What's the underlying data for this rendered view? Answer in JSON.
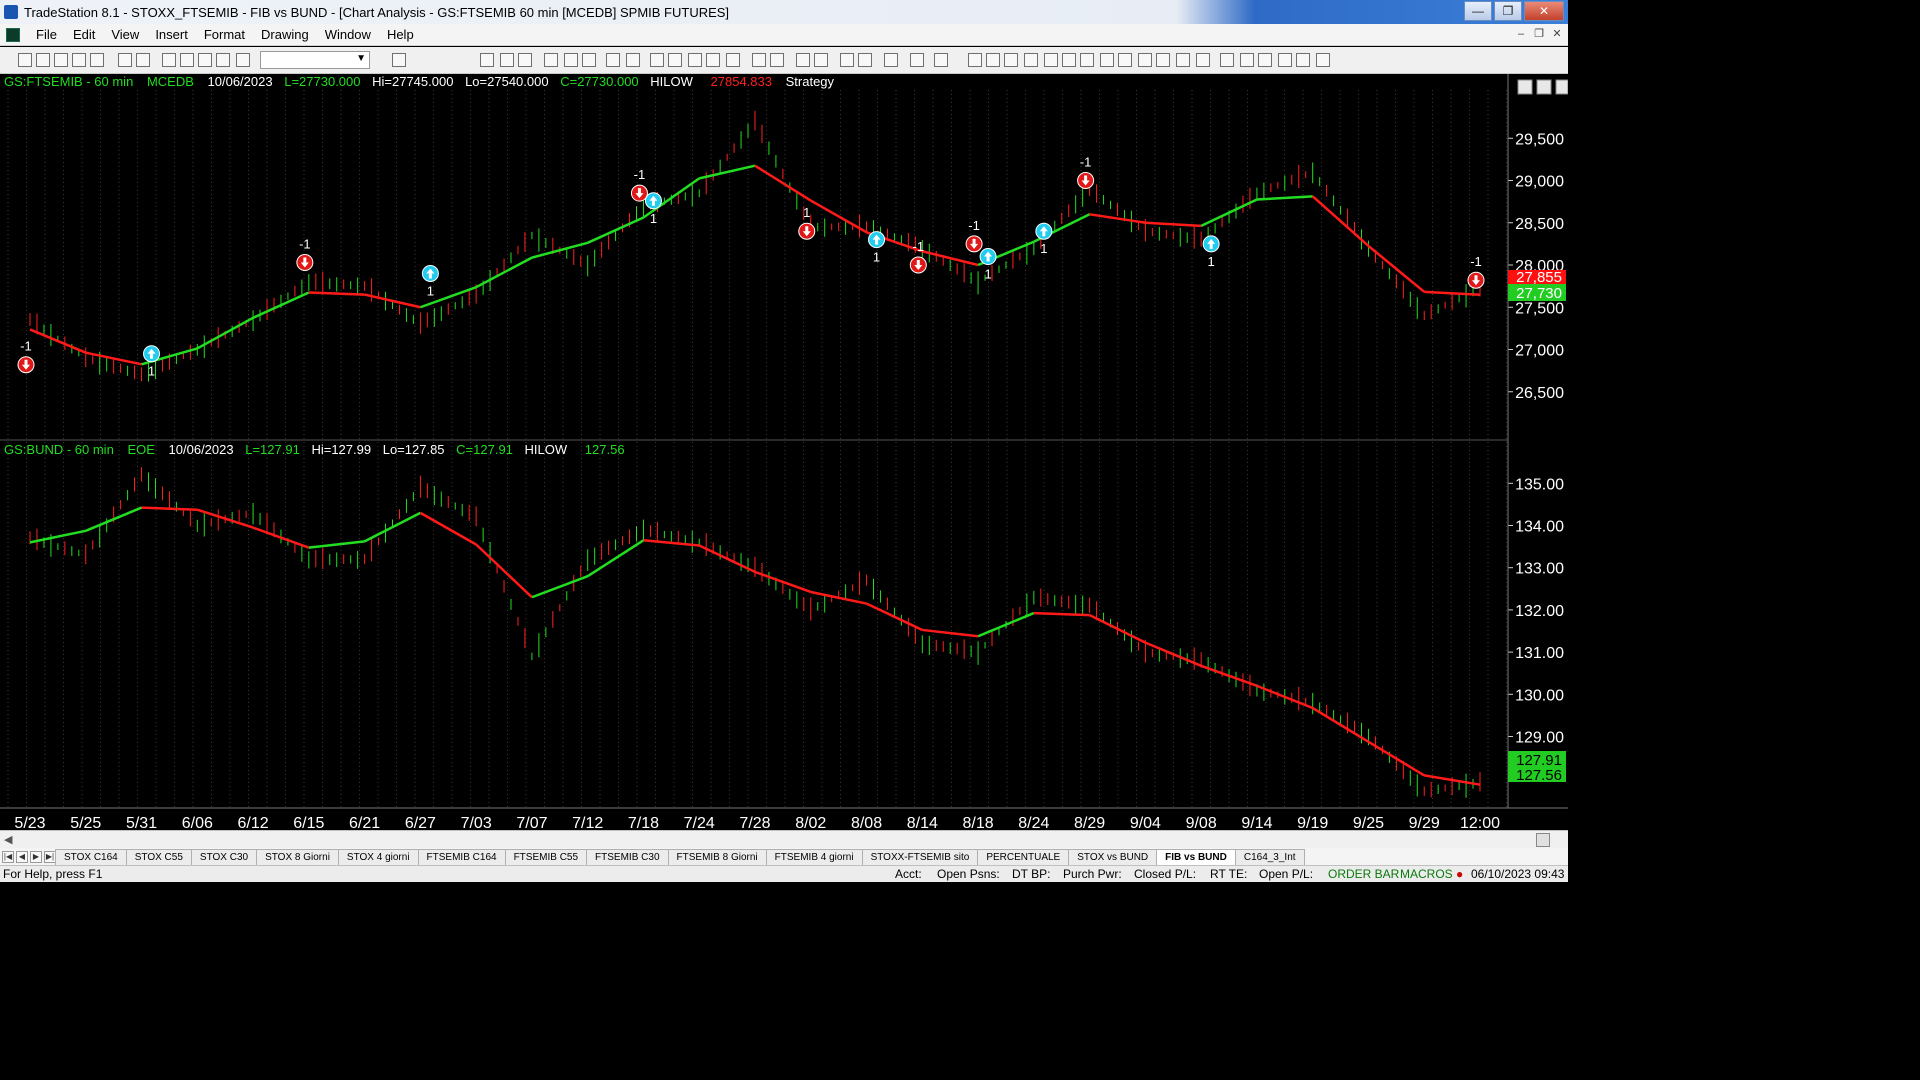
{
  "window": {
    "title": "TradeStation 8.1 - STOXX_FTSEMIB - FIB vs BUND - [Chart Analysis - GS:FTSEMIB  60 min  [MCEDB] SPMIB FUTURES]",
    "minimize": "—",
    "restore": "❐",
    "close": "✕"
  },
  "menu": [
    "File",
    "Edit",
    "View",
    "Insert",
    "Format",
    "Drawing",
    "Window",
    "Help"
  ],
  "panel1": {
    "symbol": "GS:FTSEMIB - 60 min",
    "exchange": "MCEDB",
    "date": "10/06/2023",
    "last": "L=27730.000",
    "high": "Hi=27745.000",
    "low": "Lo=27540.000",
    "close": "C=27730.000",
    "indicator": "HILOW",
    "indicator_value": "27854.833",
    "strategy": "Strategy",
    "price_tag_green": "27,730",
    "price_tag_red": "27,855"
  },
  "panel2": {
    "symbol": "GS:BUND - 60 min",
    "exchange": "EOE",
    "date": "10/06/2023",
    "last": "L=127.91",
    "high": "Hi=127.99",
    "low": "Lo=127.85",
    "close": "C=127.91",
    "indicator": "HILOW",
    "indicator_value": "127.56",
    "price_tag_green_1": "127.91",
    "price_tag_green_2": "127.56"
  },
  "chart_data": [
    {
      "type": "line",
      "title": "GS:FTSEMIB - 60 min",
      "y_ticks": [
        "29,500",
        "29,000",
        "28,500",
        "28,000",
        "27,500",
        "27,000",
        "26,500"
      ],
      "ylim": [
        26000,
        30000
      ],
      "x": [
        "5/23",
        "5/25",
        "5/31",
        "6/06",
        "6/12",
        "6/15",
        "6/21",
        "6/27",
        "7/03",
        "7/07",
        "7/12",
        "7/18",
        "7/24",
        "7/28",
        "8/02",
        "8/08",
        "8/14",
        "8/18",
        "8/24",
        "8/29",
        "9/04",
        "9/08",
        "9/14",
        "9/19",
        "9/25",
        "9/29",
        "12:00"
      ],
      "series": [
        {
          "name": "",
          "color": "#22dd22",
          "values": [
            27350,
            26900,
            26700,
            27000,
            27350,
            27800,
            27750,
            27300,
            27650,
            28350,
            28000,
            28700,
            28850,
            29700,
            28450,
            28450,
            28200,
            27800,
            28200,
            28900,
            28400,
            28300,
            28850,
            29100,
            28200,
            27400,
            27730
          ]
        }
      ],
      "signals": [
        {
          "type": "sell",
          "label": "-1",
          "date": "5/23",
          "value": 26820
        },
        {
          "type": "buy",
          "label": "1",
          "date": "5/31",
          "value": 26950
        },
        {
          "type": "sell",
          "label": "-1",
          "date": "6/15",
          "value": 28030
        },
        {
          "type": "buy",
          "label": "1",
          "date": "6/27",
          "value": 27900
        },
        {
          "type": "sell",
          "label": "-1",
          "date": "7/18",
          "value": 28850
        },
        {
          "type": "buy",
          "label": "1",
          "date": "7/18",
          "value": 28760
        },
        {
          "type": "sell",
          "label": "1",
          "date": "8/02",
          "value": 28400
        },
        {
          "type": "buy",
          "label": "1",
          "date": "8/08",
          "value": 28300
        },
        {
          "type": "sell",
          "label": "-1",
          "date": "8/14",
          "value": 28000
        },
        {
          "type": "buy",
          "label": "1",
          "date": "8/18",
          "value": 28100
        },
        {
          "type": "sell",
          "label": "-1",
          "date": "8/18",
          "value": 28250
        },
        {
          "type": "buy",
          "label": "1",
          "date": "8/24",
          "value": 28400
        },
        {
          "type": "sell",
          "label": "-1",
          "date": "8/29",
          "value": 29000
        },
        {
          "type": "buy",
          "label": "1",
          "date": "9/08",
          "value": 28250
        },
        {
          "type": "sell",
          "label": "-1",
          "date": "12:00",
          "value": 27820
        }
      ]
    },
    {
      "type": "line",
      "title": "GS:BUND - 60 min",
      "y_ticks": [
        "135.00",
        "134.00",
        "133.00",
        "132.00",
        "131.00",
        "130.00",
        "129.00"
      ],
      "ylim": [
        127.4,
        135.6
      ],
      "x": [
        "5/23",
        "5/25",
        "5/31",
        "6/06",
        "6/12",
        "6/15",
        "6/21",
        "6/27",
        "7/03",
        "7/07",
        "7/12",
        "7/18",
        "7/24",
        "7/28",
        "8/02",
        "8/08",
        "8/14",
        "8/18",
        "8/24",
        "8/29",
        "9/04",
        "9/08",
        "9/14",
        "9/19",
        "9/25",
        "9/29",
        "12:00"
      ],
      "series": [
        {
          "name": "",
          "color": "#22dd22",
          "values": [
            133.7,
            133.3,
            135.2,
            134.0,
            134.3,
            133.2,
            133.2,
            134.9,
            134.2,
            130.9,
            133.2,
            133.9,
            133.6,
            133.0,
            132.0,
            132.7,
            131.2,
            131.0,
            132.3,
            132.1,
            131.0,
            130.8,
            130.1,
            129.8,
            129.0,
            127.7,
            127.91
          ]
        }
      ]
    }
  ],
  "tabs": [
    "STOX C164",
    "STOX C55",
    "STOX  C30",
    "STOX  8 Giorni",
    "STOX 4 giorni",
    "FTSEMIB C164",
    "FTSEMIB C55",
    "FTSEMIB C30",
    "FTSEMIB  8 Giorni",
    "FTSEMIB  4 giorni",
    "STOXX-FTSEMIB sito",
    "PERCENTUALE",
    "STOX vs BUND",
    "FIB vs BUND",
    "C164_3_Int"
  ],
  "active_tab": "FIB vs BUND",
  "status": {
    "help": "For Help, press F1",
    "acct": "Acct:",
    "open_psns": "Open Psns:",
    "dt_bp": "DT BP:",
    "purch_pwr": "Purch Pwr:",
    "closed_pl": "Closed P/L:",
    "rt_te": "RT TE:",
    "open_pl": "Open P/L:",
    "order_bar": "ORDER BAR",
    "macros": "MACROS",
    "datetime": "06/10/2023 09:43"
  }
}
